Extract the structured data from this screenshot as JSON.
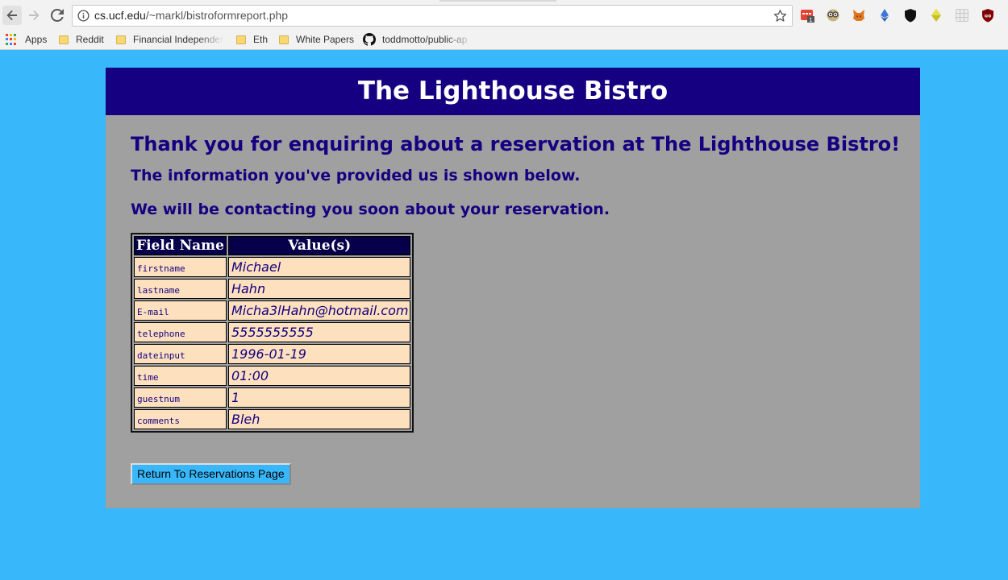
{
  "browser": {
    "url_host": "cs.ucf.edu",
    "url_path": "/~markl/bistroformreport.php",
    "extensions": [
      {
        "icon": "todoist-icon",
        "color": "#e44232",
        "badge": "1"
      },
      {
        "icon": "owl-glasses-icon",
        "color": "#7a6a3a"
      },
      {
        "icon": "metamask-fox-icon",
        "color": "#e2761b"
      },
      {
        "icon": "ethereum-icon",
        "color": "#3c78d8"
      },
      {
        "icon": "shield-icon",
        "color": "#111111"
      },
      {
        "icon": "diamond-icon",
        "color": "#c8c020"
      },
      {
        "icon": "grid-icon",
        "color": "#c8c8c8"
      },
      {
        "icon": "ublock-icon",
        "color": "#800000"
      }
    ]
  },
  "bookmarks": [
    {
      "label": "Apps",
      "icon": "apps-icon"
    },
    {
      "label": "Reddit",
      "icon": "folder-icon"
    },
    {
      "label": "Financial Independen",
      "icon": "folder-icon"
    },
    {
      "label": "Eth",
      "icon": "folder-icon"
    },
    {
      "label": "White Papers",
      "icon": "folder-icon"
    },
    {
      "label": "toddmotto/public-ap",
      "icon": "github-icon"
    }
  ],
  "page": {
    "banner_title": "The Lighthouse Bistro",
    "heading": "Thank you for enquiring about a reservation at The Lighthouse Bistro!",
    "info_line": "The information you've provided us is shown below.",
    "contact_line": "We will be contacting you soon about your reservation.",
    "table": {
      "headers": [
        "Field Name",
        "Value(s)"
      ],
      "rows": [
        {
          "field": "firstname",
          "value": "Michael"
        },
        {
          "field": "lastname",
          "value": "Hahn"
        },
        {
          "field": "E-mail",
          "value": "Micha3lHahn@hotmail.com"
        },
        {
          "field": "telephone",
          "value": "5555555555"
        },
        {
          "field": "dateinput",
          "value": "1996-01-19"
        },
        {
          "field": "time",
          "value": "01:00"
        },
        {
          "field": "guestnum",
          "value": "1"
        },
        {
          "field": "comments",
          "value": "Bleh"
        }
      ]
    },
    "return_button": "Return To Reservations Page"
  },
  "colors": {
    "page_background": "#38b8fb",
    "panel_background": "#a0a0a0",
    "banner_background": "#140080",
    "text_navy": "#140080",
    "header_cell": "#06004a",
    "value_cell": "#fde0bd"
  }
}
